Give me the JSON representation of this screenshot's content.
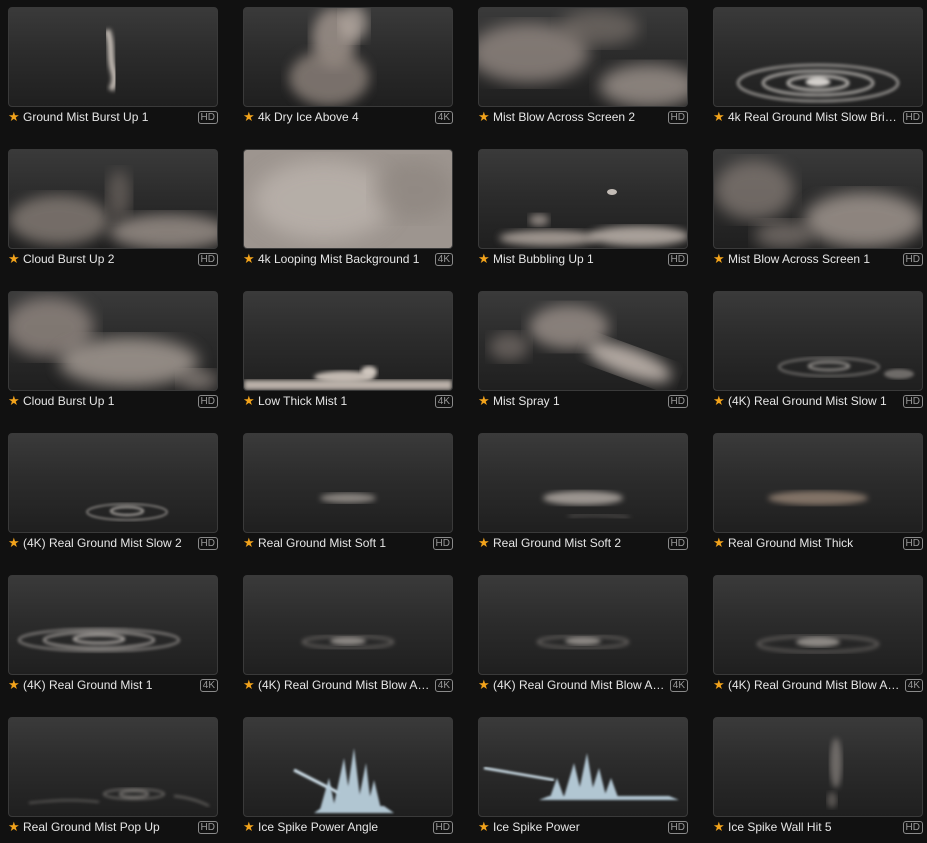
{
  "colors": {
    "background": "#111111",
    "star": "#f2a31b",
    "title_text": "#e6e6e6",
    "badge": "#9a9a9a"
  },
  "items": [
    {
      "title": "Ground Mist Burst Up 1",
      "badge": "HD",
      "thumb": "burst-up"
    },
    {
      "title": "4k Dry Ice Above 4",
      "badge": "4K",
      "thumb": "dry-ice"
    },
    {
      "title": "Mist Blow Across Screen 2",
      "badge": "HD",
      "thumb": "blow-across"
    },
    {
      "title": "4k Real Ground Mist Slow Bri…",
      "badge": "HD",
      "thumb": "ground-swirl-large"
    },
    {
      "title": "Cloud Burst Up 2",
      "badge": "HD",
      "thumb": "cloud-low"
    },
    {
      "title": "4k Looping Mist Background 1",
      "badge": "4K",
      "thumb": "full-mist"
    },
    {
      "title": "Mist Bubbling Up 1",
      "badge": "HD",
      "thumb": "bubbling"
    },
    {
      "title": "Mist Blow Across Screen 1",
      "badge": "HD",
      "thumb": "blow-across-2"
    },
    {
      "title": "Cloud Burst Up 1",
      "badge": "HD",
      "thumb": "cloud-burst"
    },
    {
      "title": "Low Thick Mist 1",
      "badge": "4K",
      "thumb": "low-thick"
    },
    {
      "title": "Mist Spray 1",
      "badge": "HD",
      "thumb": "spray"
    },
    {
      "title": "(4K) Real Ground Mist Slow 1",
      "badge": "HD",
      "thumb": "ground-swirl"
    },
    {
      "title": "(4K) Real Ground Mist Slow 2",
      "badge": "HD",
      "thumb": "ground-swirl-small"
    },
    {
      "title": "Real Ground Mist Soft 1",
      "badge": "HD",
      "thumb": "soft-glow"
    },
    {
      "title": "Real Ground Mist Soft 2",
      "badge": "HD",
      "thumb": "soft-glow-2"
    },
    {
      "title": "Real Ground Mist Thick",
      "badge": "HD",
      "thumb": "soft-glow-warm"
    },
    {
      "title": "(4K) Real Ground Mist 1",
      "badge": "4K",
      "thumb": "ground-swirl-large-low"
    },
    {
      "title": "(4K) Real Ground Mist Blow A…",
      "badge": "4K",
      "thumb": "soft-swirl"
    },
    {
      "title": "(4K) Real Ground Mist Blow A…",
      "badge": "4K",
      "thumb": "soft-swirl"
    },
    {
      "title": "(4K) Real Ground Mist Blow A…",
      "badge": "4K",
      "thumb": "soft-swirl-2"
    },
    {
      "title": "Real Ground Mist Pop Up",
      "badge": "HD",
      "thumb": "pop-up"
    },
    {
      "title": "Ice Spike Power Angle",
      "badge": "HD",
      "thumb": "ice-spike-angle"
    },
    {
      "title": "Ice Spike Power",
      "badge": "HD",
      "thumb": "ice-spike"
    },
    {
      "title": "Ice Spike Wall Hit 5",
      "badge": "HD",
      "thumb": "wall-hit"
    }
  ]
}
